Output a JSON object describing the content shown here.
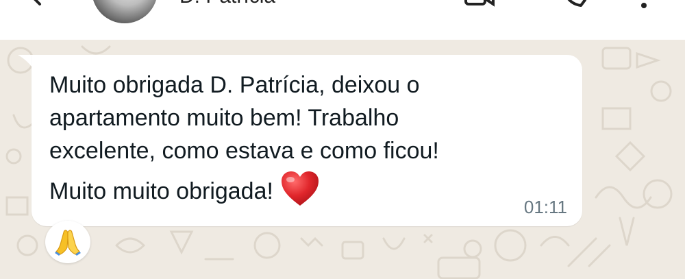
{
  "header": {
    "contact_name": "D. Patrícia"
  },
  "message": {
    "lines": [
      "Muito obrigada D. Patrícia,  deixou o",
      "apartamento muito bem! Trabalho",
      "excelente,  como estava e como ficou!"
    ],
    "last_line": "Muito muito obrigada!",
    "emoji": "red-heart",
    "time": "01:11"
  },
  "reaction": {
    "emoji": "folded-hands"
  },
  "colors": {
    "header_bg": "#ffffff",
    "wallpaper_bg": "#efeae2",
    "bubble_bg": "#ffffff",
    "text": "#111b21",
    "timestamp": "#667781",
    "heart": "#e0262b"
  }
}
